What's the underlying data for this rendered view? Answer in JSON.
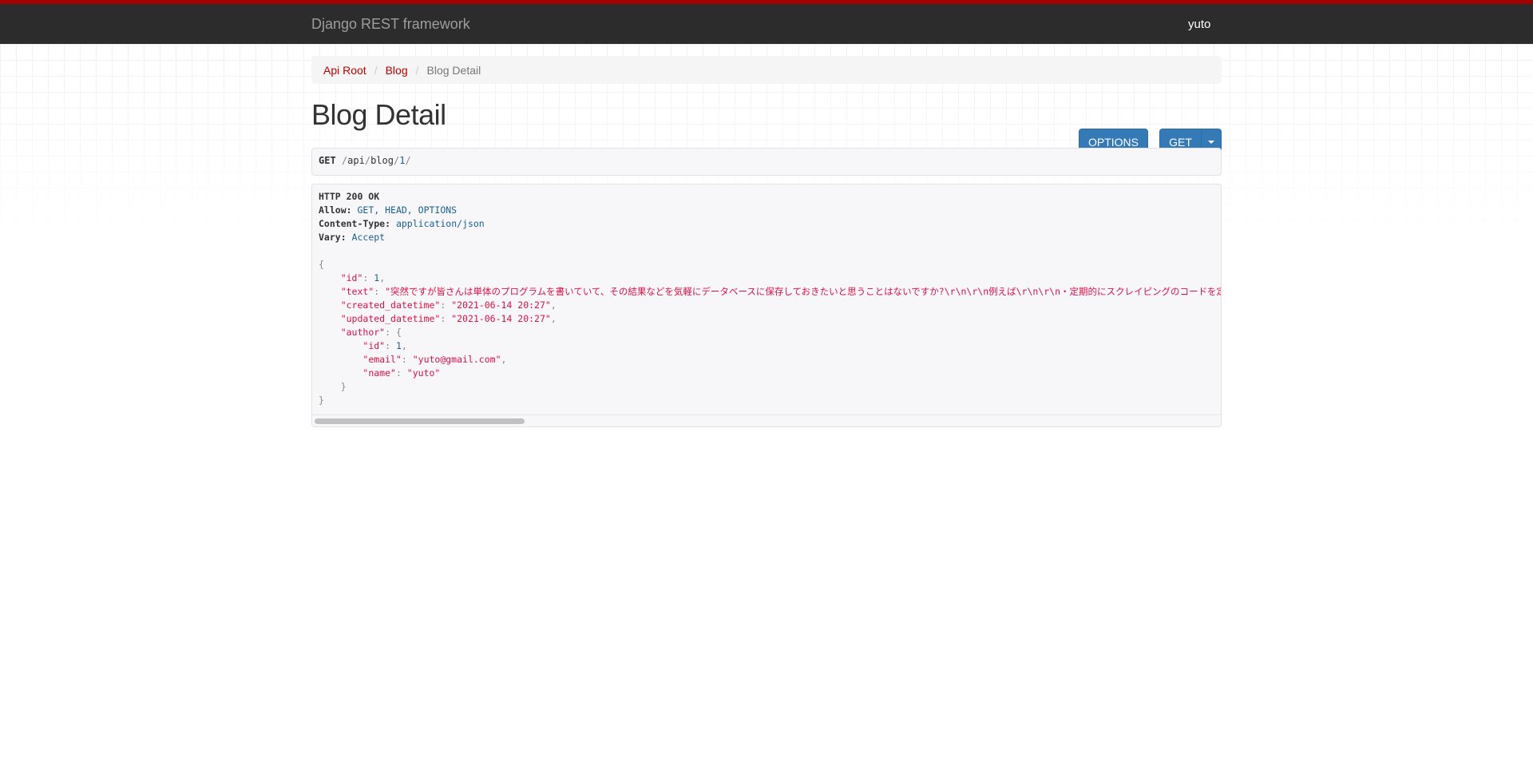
{
  "navbar": {
    "brand": "Django REST framework",
    "user": "yuto"
  },
  "breadcrumb": {
    "items": [
      "Api Root",
      "Blog"
    ],
    "active": "Blog Detail"
  },
  "page": {
    "title": "Blog Detail"
  },
  "buttons": {
    "options": "OPTIONS",
    "get": "GET"
  },
  "request": {
    "method": "GET",
    "path_parts": [
      "/",
      "api",
      "/",
      "blog",
      "/",
      "1",
      "/"
    ]
  },
  "response": {
    "status": "HTTP 200 OK",
    "headers": [
      {
        "name": "Allow:",
        "value": "GET, HEAD, OPTIONS"
      },
      {
        "name": "Content-Type:",
        "value": "application/json"
      },
      {
        "name": "Vary:",
        "value": "Accept"
      }
    ],
    "body": {
      "id_key": "\"id\"",
      "id_val": "1",
      "text_key": "\"text\"",
      "text_val": "\"突然ですが皆さんは単体のプログラムを書いていて、その結果などを気軽にデータベースに保存しておきたいと思うことはないですか?\\r\\n\\r\\n例えば\\r\\n\\r\\n・定期的にスクレイピングのコードを定期稼働",
      "created_key": "\"created_datetime\"",
      "created_val": "\"2021-06-14 20:27\"",
      "updated_key": "\"updated_datetime\"",
      "updated_val": "\"2021-06-14 20:27\"",
      "author_key": "\"author\"",
      "author": {
        "id_key": "\"id\"",
        "id_val": "1",
        "email_key": "\"email\"",
        "email_val": "\"yuto@gmail.com\"",
        "name_key": "\"name\"",
        "name_val": "\"yuto\""
      }
    }
  },
  "colors": {
    "accent_red": "#a30000",
    "link_red": "#c20000",
    "primary_blue": "#337ab7",
    "navbar_bg": "#2c2c2c",
    "json_string": "#dd1144",
    "json_literal": "#195f91"
  }
}
